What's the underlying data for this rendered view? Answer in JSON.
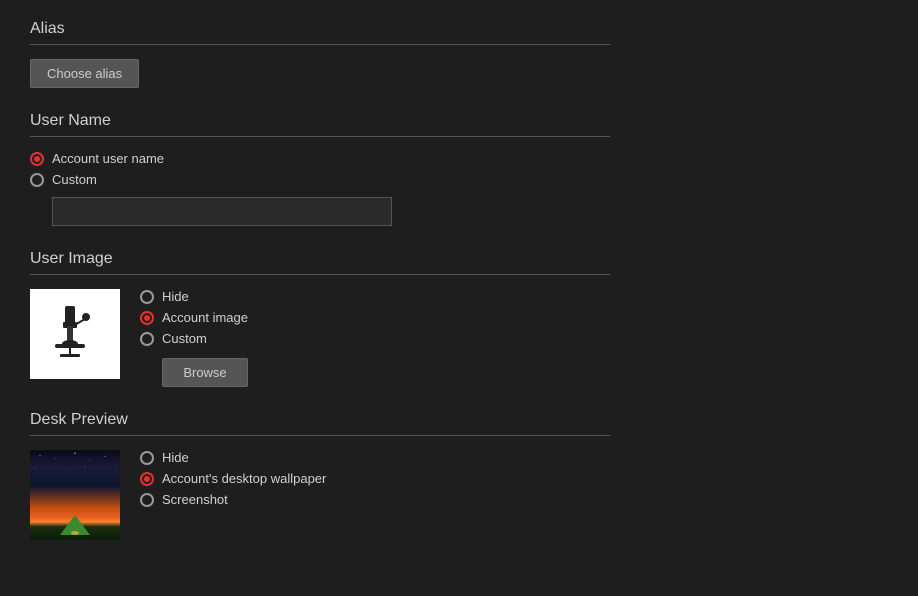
{
  "alias": {
    "section_title": "Alias",
    "button_label": "Choose alias"
  },
  "username": {
    "section_title": "User Name",
    "account_username_label": "Account user name",
    "custom_label": "Custom",
    "custom_input_placeholder": "",
    "selected": "account"
  },
  "user_image": {
    "section_title": "User Image",
    "hide_label": "Hide",
    "account_image_label": "Account image",
    "custom_label": "Custom",
    "browse_label": "Browse",
    "selected": "account_image"
  },
  "desk_preview": {
    "section_title": "Desk Preview",
    "hide_label": "Hide",
    "account_wallpaper_label": "Account's desktop wallpaper",
    "screenshot_label": "Screenshot",
    "selected": "account_wallpaper"
  }
}
